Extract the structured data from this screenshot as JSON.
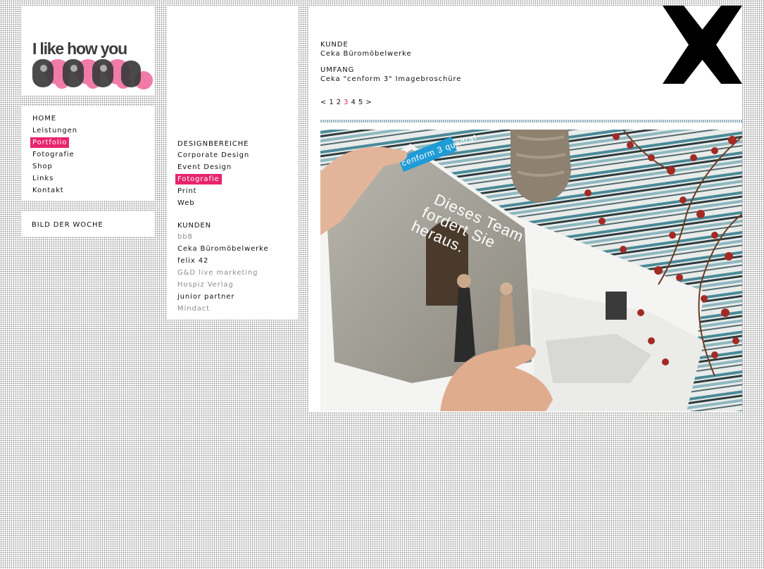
{
  "logo": {
    "line1": "I like how you",
    "line2": "feel"
  },
  "nav": {
    "items": [
      {
        "label": "HOME",
        "active": false
      },
      {
        "label": "Leistungen",
        "active": false
      },
      {
        "label": "Portfolio",
        "active": true
      },
      {
        "label": "Fotografie",
        "active": false
      },
      {
        "label": "Shop",
        "active": false
      },
      {
        "label": "Links",
        "active": false
      },
      {
        "label": "Kontakt",
        "active": false
      }
    ]
  },
  "bild_der_woche": "BILD DER WOCHE",
  "designbereiche": {
    "heading": "DESIGNBEREICHE",
    "items": [
      "Corporate Design",
      "Event Design",
      "Fotografie",
      "Print",
      "Web"
    ],
    "active_index": 2
  },
  "kunden": {
    "heading": "KUNDEN",
    "items": [
      "bb8",
      "Ceka Büromöbelwerke",
      "felix 42",
      "G&D live marketing",
      "Hospiz Verlag",
      "junior partner",
      "Mindact"
    ],
    "dim": [
      true,
      false,
      false,
      true,
      true,
      false,
      true
    ]
  },
  "project": {
    "kunde_label": "KUNDE",
    "kunde_value": "Ceka Büromöbelwerke",
    "umfang_label": "UMFANG",
    "umfang_value": "Ceka \"cenform 3\" Imagebroschüre"
  },
  "pager": {
    "prev": "<",
    "pages": [
      "1",
      "2",
      "3",
      "4",
      "5"
    ],
    "current": "3",
    "next": ">"
  },
  "close_icon": "x-close-icon",
  "photo": {
    "banner": "cenform 3 quadrat",
    "headline": [
      "Dieses Team",
      "fordert Sie",
      "heraus."
    ]
  },
  "colors": {
    "accent": "#e8246e",
    "logo_pink": "#f07ba6",
    "logo_dark": "#3b3b3b",
    "dim_text": "#8d8d8d",
    "banner_blue": "#1f9bd6"
  }
}
